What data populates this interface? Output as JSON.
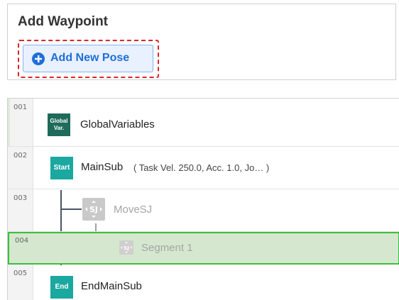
{
  "waypoint_panel": {
    "title": "Add Waypoint",
    "button_label": "Add New Pose",
    "button_icon": "plus-circle-icon",
    "accent_color": "#1f6fd8",
    "highlight_color": "#d9272e"
  },
  "task_list": {
    "rows": [
      {
        "line": "001",
        "badge": "Global Var.",
        "badge_line1": "Global",
        "badge_line2": "Var.",
        "label": "GlobalVariables"
      },
      {
        "line": "002",
        "badge": "Start",
        "label": "MainSub",
        "params": "( Task Vel. 250.0, Acc. 1.0, Jo… )"
      },
      {
        "line": "003",
        "icon": "movesj-icon",
        "icon_text": "SJ",
        "label": "MoveSJ"
      },
      {
        "line": "004",
        "icon": "segment-sj-icon",
        "icon_text": "SJ",
        "label": "Segment 1",
        "selected": true
      },
      {
        "line": "005",
        "badge": "End",
        "label": "EndMainSub"
      }
    ],
    "selected_color": "#3cbf3c"
  }
}
